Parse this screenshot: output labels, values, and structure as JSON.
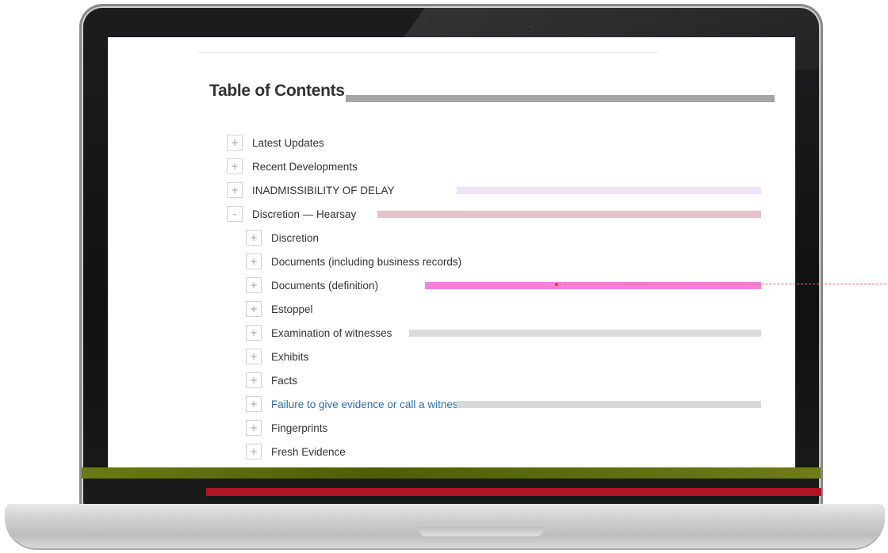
{
  "toc": {
    "title": "Table of Contents",
    "items": [
      {
        "toggle": "+",
        "label": "Latest Updates",
        "level": 0
      },
      {
        "toggle": "+",
        "label": "Recent Developments",
        "level": 0
      },
      {
        "toggle": "+",
        "label": "INADMISSIBILITY OF DELAY",
        "level": 0
      },
      {
        "toggle": "-",
        "label": "Discretion — Hearsay",
        "level": 0
      },
      {
        "toggle": "+",
        "label": "Discretion",
        "level": 1
      },
      {
        "toggle": "+",
        "label": "Documents (including business records)",
        "level": 1
      },
      {
        "toggle": "+",
        "label": "Documents (definition)",
        "level": 1
      },
      {
        "toggle": "+",
        "label": "Estoppel",
        "level": 1
      },
      {
        "toggle": "+",
        "label": "Examination of witnesses",
        "level": 1
      },
      {
        "toggle": "+",
        "label": "Exhibits",
        "level": 1
      },
      {
        "toggle": "+",
        "label": "Facts",
        "level": 1
      },
      {
        "toggle": "+",
        "label": "Failure to give evidence or call a witness",
        "level": 1,
        "link": true
      },
      {
        "toggle": "+",
        "label": "Fingerprints",
        "level": 1
      },
      {
        "toggle": "+",
        "label": "Fresh Evidence",
        "level": 1
      }
    ]
  }
}
